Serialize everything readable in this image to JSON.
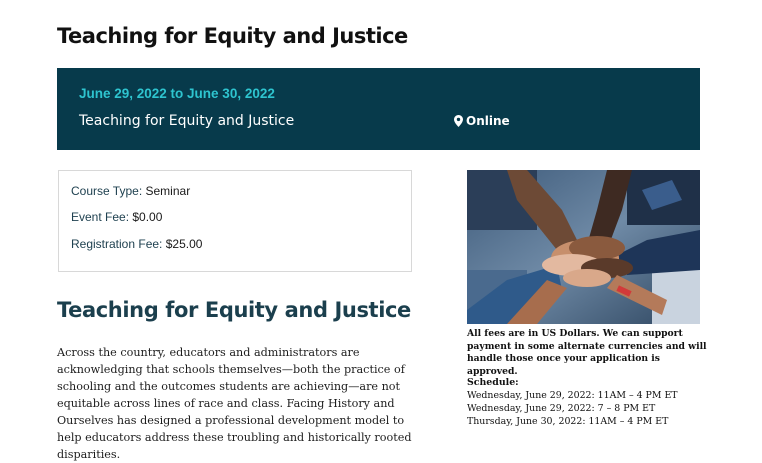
{
  "page": {
    "title": "Teaching for Equity and Justice"
  },
  "banner": {
    "dates": "June 29, 2022 to June 30, 2022",
    "title": "Teaching for Equity and Justice",
    "location": "Online",
    "location_icon": "map-pin-icon",
    "background_color": "#073a4b",
    "date_color": "#2ec4cf"
  },
  "details": {
    "course_type_label": "Course Type:",
    "course_type_value": "Seminar",
    "event_fee_label": "Event Fee:",
    "event_fee_value": "$0.00",
    "registration_fee_label": "Registration Fee:",
    "registration_fee_value": "$25.00"
  },
  "main": {
    "heading": "Teaching for Equity and Justice",
    "paragraph": "Across the country, educators and administrators are acknowledging that schools themselves—both the practice of schooling and the outcomes students are achieving—are not equitable across lines of race and class. Facing History and Ourselves has designed a professional development model to help educators address these troubling and historically rooted disparities."
  },
  "sidebar": {
    "image_subject": "stacked-hands-photo",
    "fees_note": "All fees are in US Dollars. We can support payment in some alternate currencies and will handle those once your application is approved.",
    "schedule_heading": "Schedule:",
    "schedule": [
      "Wednesday, June 29, 2022: 11AM – 4 PM ET",
      "Wednesday, June 29, 2022: 7 – 8 PM ET",
      "Thursday, June 30, 2022: 11AM – 4 PM ET"
    ]
  }
}
